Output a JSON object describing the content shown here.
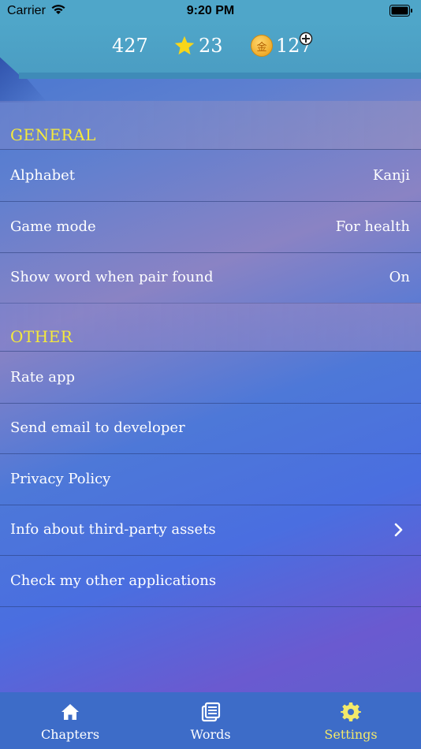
{
  "status_bar": {
    "carrier": "Carrier",
    "time": "9:20 PM"
  },
  "stats": {
    "count": "427",
    "stars": "23",
    "coins": "127",
    "coin_glyph": "金"
  },
  "sections": [
    {
      "title": "GENERAL",
      "rows": [
        {
          "label": "Alphabet",
          "value": "Kanji"
        },
        {
          "label": "Game mode",
          "value": "For health"
        },
        {
          "label": "Show word when pair found",
          "value": "On"
        }
      ]
    },
    {
      "title": "OTHER",
      "rows": [
        {
          "label": "Rate app"
        },
        {
          "label": "Send email to developer"
        },
        {
          "label": "Privacy Policy"
        },
        {
          "label": "Info about third-party assets",
          "icon": "chevron-right-icon"
        },
        {
          "label": "Check my other applications"
        }
      ]
    }
  ],
  "tabs": [
    {
      "label": "Chapters",
      "icon": "home-icon",
      "selected": false
    },
    {
      "label": "Words",
      "icon": "book-icon",
      "selected": false
    },
    {
      "label": "Settings",
      "icon": "gear-icon",
      "selected": true
    }
  ],
  "colors": {
    "accent": "#f5ea3b",
    "selected_tab": "#f3e96a",
    "banner": "#4fa6c9",
    "tab_bar": "#3d6cc8"
  }
}
